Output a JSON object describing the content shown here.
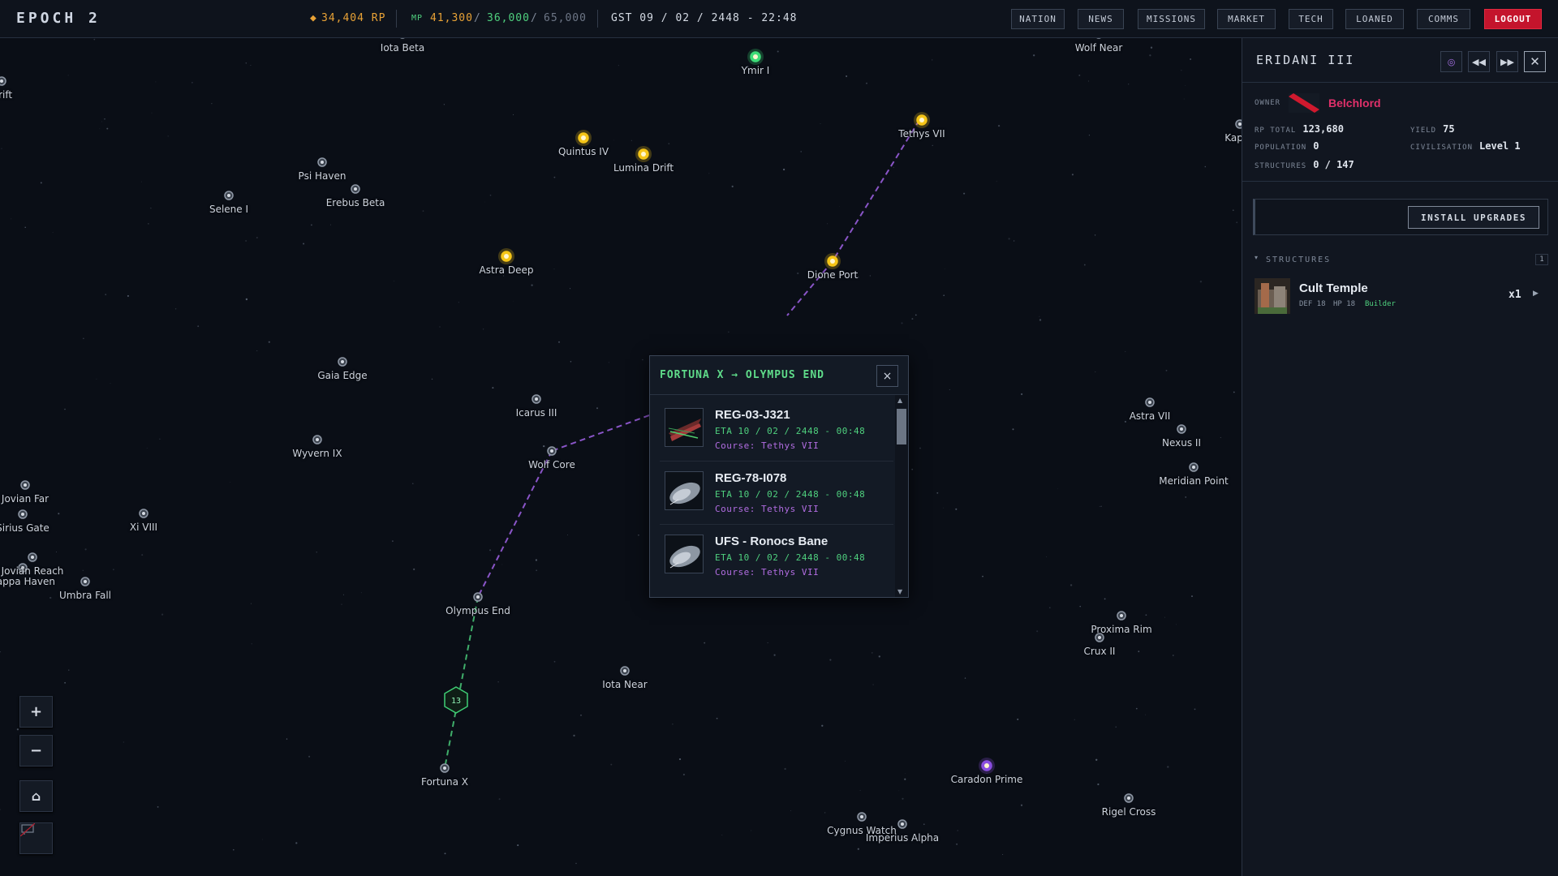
{
  "app": {
    "brand": "EPOCH 2",
    "rp": "34,404 RP",
    "mp_label": "MP",
    "mp_current": "41,300",
    "mp_target": "36,000",
    "mp_max": "65,000",
    "mp_sep": "/",
    "gst": "GST 09 / 02 / 2448 - 22:48",
    "colors": {
      "accent_green": "#4fd07e",
      "accent_orange": "#e8a236",
      "logout_red": "#c4142c",
      "course_purple": "#b26de2"
    }
  },
  "nav": [
    {
      "label": "NATION"
    },
    {
      "label": "NEWS"
    },
    {
      "label": "MISSIONS"
    },
    {
      "label": "MARKET"
    },
    {
      "label": "TECH"
    },
    {
      "label": "LOANED"
    },
    {
      "label": "COMMS"
    },
    {
      "label": "LOGOUT"
    }
  ],
  "map": {
    "systems": [
      {
        "name": "Iota Beta",
        "type": "neutral"
      },
      {
        "name": "Ymir I",
        "type": "green"
      },
      {
        "name": "Wolf Near",
        "type": "neutral"
      },
      {
        "name": "Drift",
        "type": "neutral"
      },
      {
        "name": "Quintus IV",
        "type": "yellow"
      },
      {
        "name": "Lumina Drift",
        "type": "yellow"
      },
      {
        "name": "Tethys VII",
        "type": "yellow"
      },
      {
        "name": "Kappa",
        "type": "neutral"
      },
      {
        "name": "Psi Haven",
        "type": "neutral"
      },
      {
        "name": "Erebus Beta",
        "type": "neutral"
      },
      {
        "name": "Selene I",
        "type": "neutral"
      },
      {
        "name": "Astra Deep",
        "type": "yellow"
      },
      {
        "name": "Dione Port",
        "type": "yellow"
      },
      {
        "name": "Gaia Edge",
        "type": "neutral"
      },
      {
        "name": "Icarus III",
        "type": "neutral"
      },
      {
        "name": "Wyvern IX",
        "type": "neutral"
      },
      {
        "name": "Wolf Core",
        "type": "neutral"
      },
      {
        "name": "Astra VII",
        "type": "neutral"
      },
      {
        "name": "Nexus II",
        "type": "neutral"
      },
      {
        "name": "Meridian Point",
        "type": "neutral"
      },
      {
        "name": "Jovian Far",
        "type": "neutral"
      },
      {
        "name": "Sirius Gate",
        "type": "neutral"
      },
      {
        "name": "Xi VIII",
        "type": "neutral"
      },
      {
        "name": "Jovian Reach",
        "type": "neutral"
      },
      {
        "name": "Kappa Haven",
        "type": "neutral"
      },
      {
        "name": "Umbra Fall",
        "type": "neutral"
      },
      {
        "name": "Olympus End",
        "type": "neutral"
      },
      {
        "name": "Proxima Rim",
        "type": "neutral"
      },
      {
        "name": "Crux II",
        "type": "neutral"
      },
      {
        "name": "Iota Near",
        "type": "neutral"
      },
      {
        "name": "Fortuna X",
        "type": "neutral"
      },
      {
        "name": "Caradon Prime",
        "type": "purple"
      },
      {
        "name": "Rigel Cross",
        "type": "neutral"
      },
      {
        "name": "Cygnus Watch",
        "type": "neutral"
      },
      {
        "name": "Imperius Alpha",
        "type": "neutral"
      }
    ],
    "fleet_count": "13",
    "controls": {
      "zoom_in": "+",
      "zoom_out": "−",
      "home": "⌂",
      "chat": "▭"
    }
  },
  "route_popup": {
    "title": "FORTUNA X → OLYMPUS END",
    "close": "×",
    "ships": [
      {
        "name": "REG-03-J321",
        "eta": "ETA 10 / 02 / 2448 - 00:48",
        "course": "Course: Tethys VII",
        "icon": "red-warship"
      },
      {
        "name": "REG-78-I078",
        "eta": "ETA 10 / 02 / 2448 - 00:48",
        "course": "Course: Tethys VII",
        "icon": "grey-cruiser"
      },
      {
        "name": "UFS - Ronocs Bane",
        "eta": "ETA 10 / 02 / 2448 - 00:48",
        "course": "Course: Tethys VII",
        "icon": "grey-cruiser"
      }
    ]
  },
  "planet": {
    "name": "ERIDANI III",
    "owner_label": "OWNER",
    "owner": "Belchlord",
    "rp_total_label": "RP TOTAL",
    "rp_total": "123,680",
    "yield_label": "YIELD",
    "yield": "75",
    "population_label": "POPULATION",
    "population": "0",
    "civilisation_label": "CIVILISATION",
    "civilisation": "Level 1",
    "structures_label": "STRUCTURES",
    "structures": "0 / 147",
    "install_label": "INSTALL UPGRADES",
    "structures_section": "STRUCTURES",
    "structures_count": "1",
    "structure_list": [
      {
        "name": "Cult Temple",
        "def": "DEF 18",
        "hp": "HP 18",
        "role": "Builder",
        "qty": "x1"
      }
    ]
  }
}
